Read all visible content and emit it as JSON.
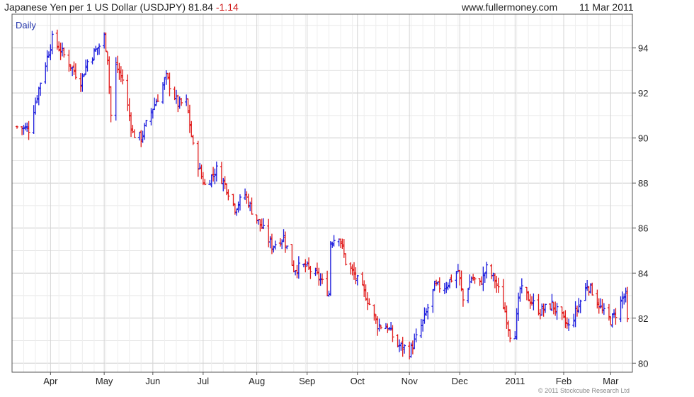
{
  "header": {
    "title": "Japanese Yen per 1 US Dollar (USDJPY)",
    "last": "81.84",
    "change": "-1.14",
    "site": "www.fullermoney.com",
    "date": "11 Mar 2011"
  },
  "chart_label": "Daily",
  "credit": "© 2011 Stockcube Research Ltd",
  "colors": {
    "up": "#1a1adc",
    "down": "#e01818",
    "grid": "#dddddd",
    "axis": "#555555"
  },
  "chart_data": {
    "type": "ohlc",
    "title": "Japanese Yen per 1 US Dollar (USDJPY)",
    "interval": "daily",
    "x_range": [
      "2010-03-12",
      "2011-03-11"
    ],
    "ylim": [
      79.6,
      95.5
    ],
    "y_ticks": [
      80,
      82,
      84,
      86,
      88,
      90,
      92,
      94
    ],
    "x_ticks": [
      {
        "label": "Apr",
        "date": "2010-04-01"
      },
      {
        "label": "May",
        "date": "2010-05-03"
      },
      {
        "label": "Jun",
        "date": "2010-06-01"
      },
      {
        "label": "Jul",
        "date": "2010-07-01"
      },
      {
        "label": "Aug",
        "date": "2010-08-02"
      },
      {
        "label": "Sep",
        "date": "2010-09-01"
      },
      {
        "label": "Oct",
        "date": "2010-10-01"
      },
      {
        "label": "Nov",
        "date": "2010-11-01"
      },
      {
        "label": "Dec",
        "date": "2010-12-01"
      },
      {
        "label": "2011",
        "date": "2011-01-03"
      },
      {
        "label": "Feb",
        "date": "2011-02-01"
      },
      {
        "label": "Mar",
        "date": "2011-03-01"
      }
    ],
    "close_path": [
      [
        "2010-03-12",
        90.5
      ],
      [
        "2010-03-19",
        90.4
      ],
      [
        "2010-03-26",
        92.5
      ],
      [
        "2010-04-02",
        94.4
      ],
      [
        "2010-04-07",
        93.9
      ],
      [
        "2010-04-14",
        93.1
      ],
      [
        "2010-04-19",
        92.5
      ],
      [
        "2010-04-23",
        93.4
      ],
      [
        "2010-04-30",
        94.1
      ],
      [
        "2010-05-03",
        94.5
      ],
      [
        "2010-05-05",
        93.6
      ],
      [
        "2010-05-07",
        91.0
      ],
      [
        "2010-05-10",
        93.2
      ],
      [
        "2010-05-14",
        92.6
      ],
      [
        "2010-05-20",
        90.2
      ],
      [
        "2010-05-25",
        90.0
      ],
      [
        "2010-05-31",
        91.2
      ],
      [
        "2010-06-04",
        91.8
      ],
      [
        "2010-06-09",
        92.7
      ],
      [
        "2010-06-16",
        91.5
      ],
      [
        "2010-06-21",
        91.6
      ],
      [
        "2010-06-25",
        89.6
      ],
      [
        "2010-06-30",
        88.3
      ],
      [
        "2010-07-02",
        87.9
      ],
      [
        "2010-07-09",
        88.6
      ],
      [
        "2010-07-15",
        87.8
      ],
      [
        "2010-07-20",
        86.9
      ],
      [
        "2010-07-26",
        87.5
      ],
      [
        "2010-07-30",
        86.8
      ],
      [
        "2010-08-02",
        86.4
      ],
      [
        "2010-08-06",
        85.9
      ],
      [
        "2010-08-11",
        85.2
      ],
      [
        "2010-08-18",
        85.6
      ],
      [
        "2010-08-24",
        84.2
      ],
      [
        "2010-08-31",
        84.3
      ],
      [
        "2010-09-08",
        83.8
      ],
      [
        "2010-09-14",
        83.1
      ],
      [
        "2010-09-15",
        85.4
      ],
      [
        "2010-09-20",
        85.7
      ],
      [
        "2010-09-24",
        84.5
      ],
      [
        "2010-09-30",
        83.8
      ],
      [
        "2010-10-06",
        83.0
      ],
      [
        "2010-10-13",
        81.7
      ],
      [
        "2010-10-19",
        81.6
      ],
      [
        "2010-10-25",
        80.8
      ],
      [
        "2010-10-29",
        80.7
      ],
      [
        "2010-11-01",
        80.5
      ],
      [
        "2010-11-05",
        81.1
      ],
      [
        "2010-11-10",
        82.0
      ],
      [
        "2010-11-16",
        83.4
      ],
      [
        "2010-11-22",
        83.4
      ],
      [
        "2010-11-30",
        84.1
      ],
      [
        "2010-12-03",
        82.8
      ],
      [
        "2010-12-08",
        83.8
      ],
      [
        "2010-12-13",
        83.5
      ],
      [
        "2010-12-17",
        84.2
      ],
      [
        "2010-12-22",
        83.7
      ],
      [
        "2010-12-28",
        82.3
      ],
      [
        "2010-12-31",
        81.3
      ],
      [
        "2011-01-03",
        81.4
      ],
      [
        "2011-01-06",
        83.3
      ],
      [
        "2011-01-12",
        82.8
      ],
      [
        "2011-01-18",
        82.3
      ],
      [
        "2011-01-25",
        82.6
      ],
      [
        "2011-01-31",
        82.0
      ],
      [
        "2011-02-04",
        81.6
      ],
      [
        "2011-02-09",
        82.4
      ],
      [
        "2011-02-15",
        83.5
      ],
      [
        "2011-02-18",
        83.2
      ],
      [
        "2011-02-24",
        82.3
      ],
      [
        "2011-03-01",
        81.9
      ],
      [
        "2011-03-04",
        82.2
      ],
      [
        "2011-03-08",
        82.9
      ],
      [
        "2011-03-10",
        82.98
      ],
      [
        "2011-03-11",
        81.84
      ]
    ]
  }
}
